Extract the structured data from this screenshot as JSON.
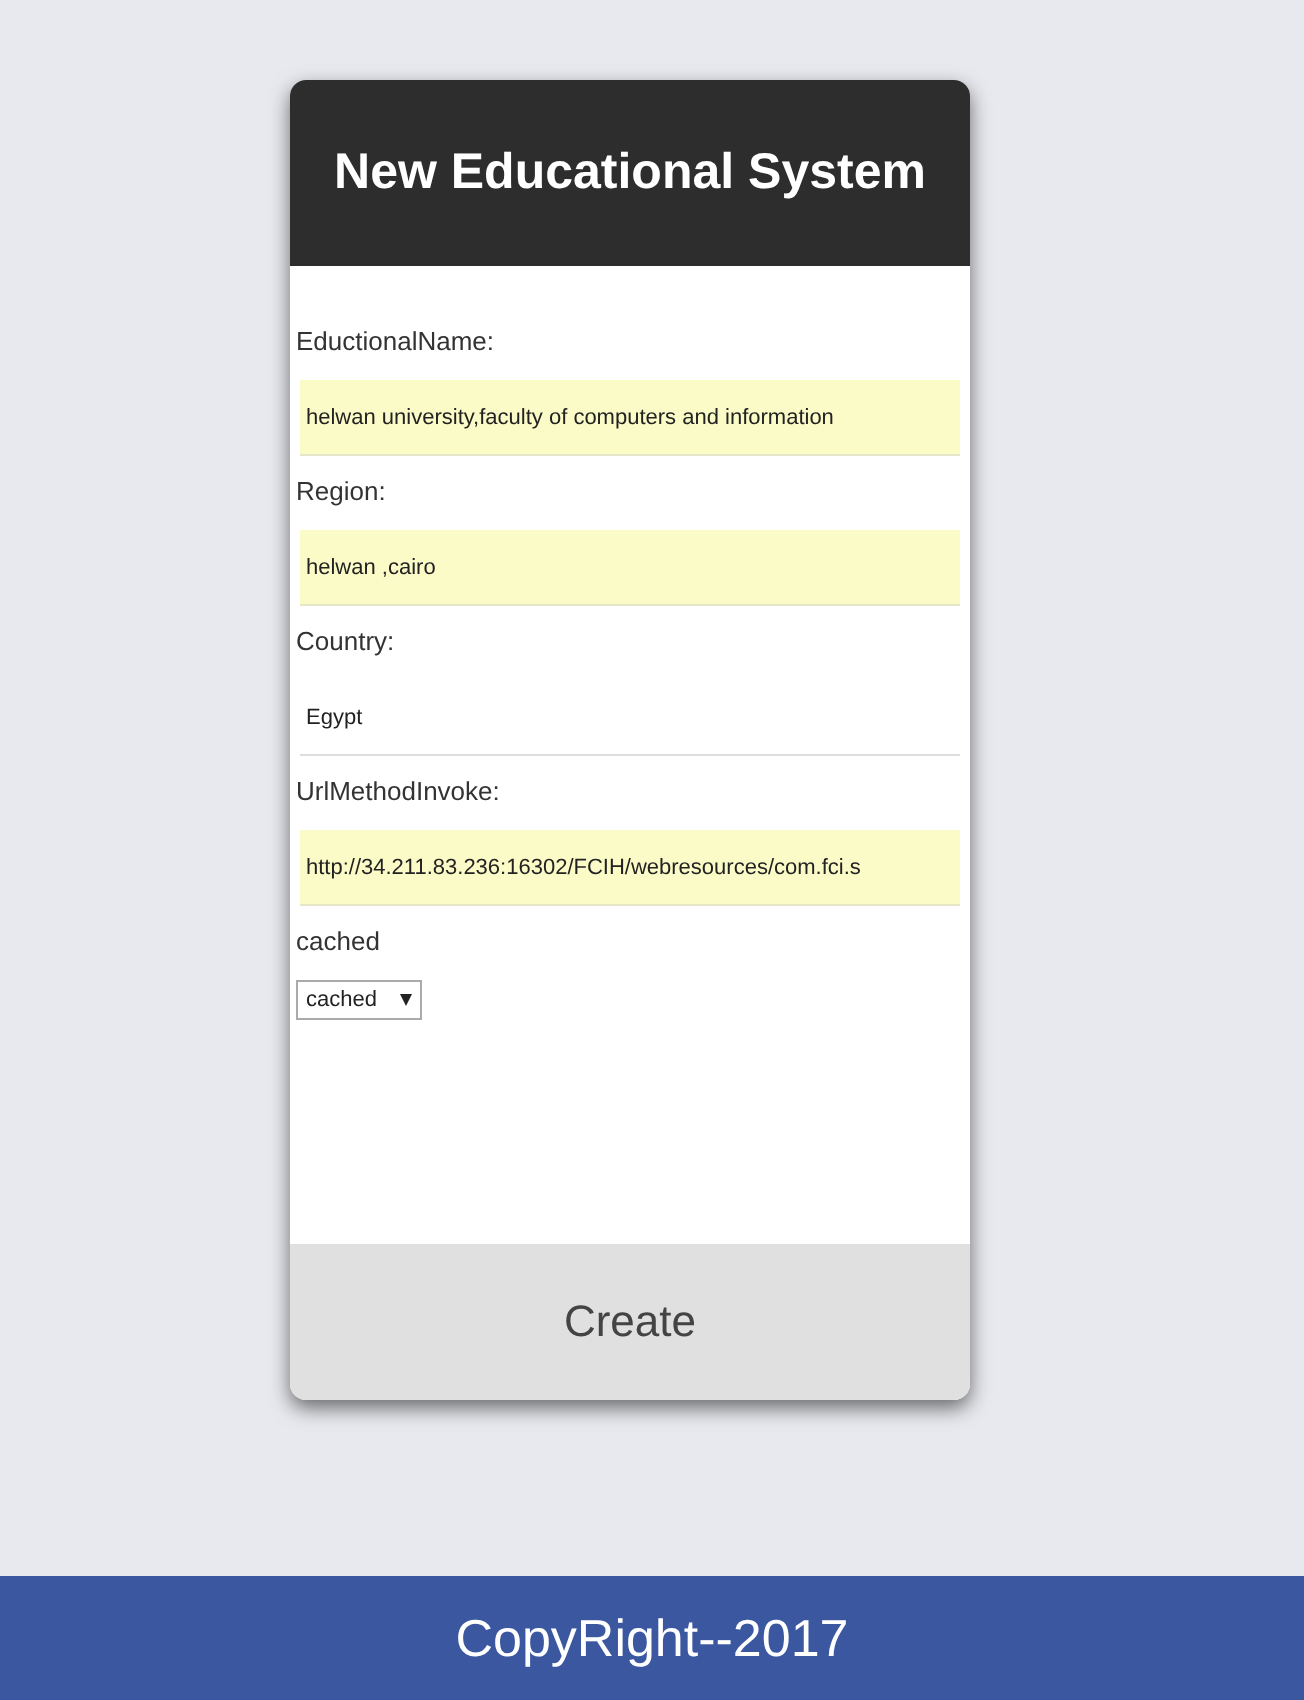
{
  "card": {
    "title": "New Educational System",
    "fields": [
      {
        "label": "EductionalName:",
        "value": "helwan university,faculty of computers and information",
        "autofilled": true
      },
      {
        "label": "Region:",
        "value": "helwan ,cairo",
        "autofilled": true
      },
      {
        "label": "Country:",
        "value": "Egypt",
        "autofilled": false
      },
      {
        "label": "UrlMethodInvoke:",
        "value": "http://34.211.83.236:16302/FCIH/webresources/com.fci.s",
        "autofilled": true
      }
    ],
    "select": {
      "label": "cached",
      "value": "cached"
    },
    "button": "Create"
  },
  "footer": "CopyRight--2017"
}
